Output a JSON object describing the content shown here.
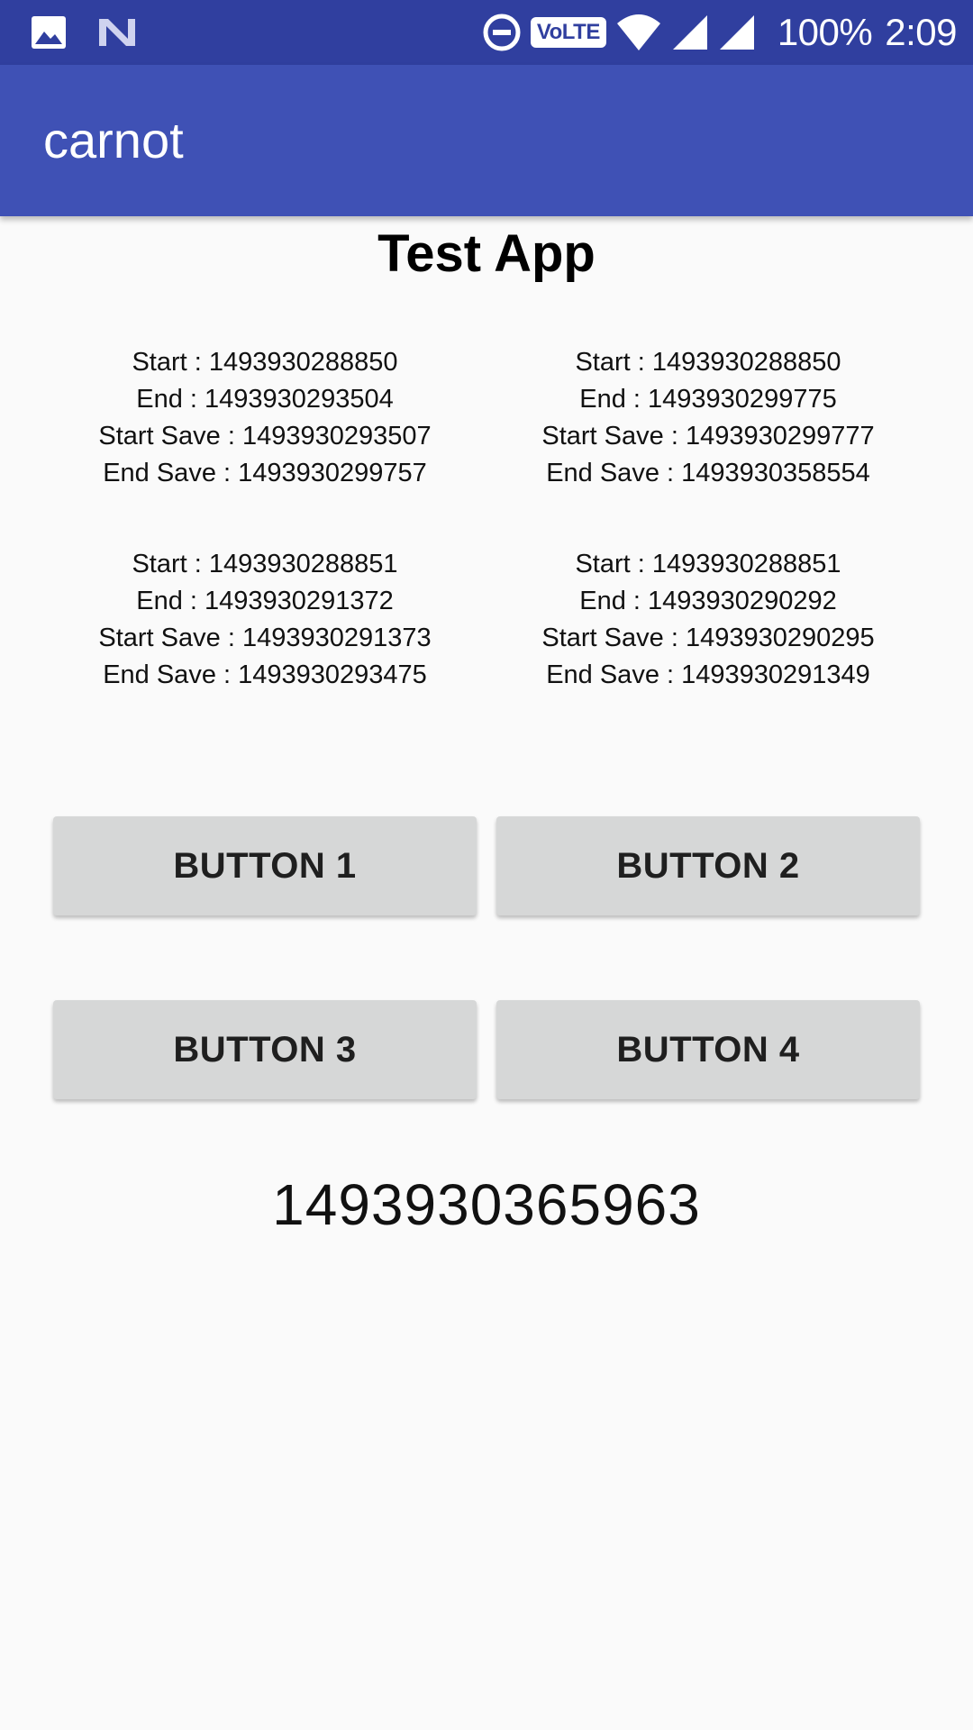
{
  "status_bar": {
    "left_icons": [
      "image-icon",
      "n-notification-icon"
    ],
    "right_icons": [
      "do-not-disturb-icon",
      "volte-badge",
      "wifi-icon",
      "signal-icon-1",
      "signal-icon-2"
    ],
    "volte_label": "VoLTE",
    "battery": "100%",
    "time": "2:09",
    "color": "#303f9f"
  },
  "app_bar": {
    "title": "carnot",
    "color": "#3f51b5"
  },
  "page": {
    "title": "Test App"
  },
  "stats": [
    {
      "start": "Start : 1493930288850",
      "end": "End : 1493930293504",
      "start_save": "Start Save : 1493930293507",
      "end_save": "End Save : 1493930299757"
    },
    {
      "start": "Start : 1493930288850",
      "end": "End : 1493930299775",
      "start_save": "Start Save : 1493930299777",
      "end_save": "End Save : 1493930358554"
    },
    {
      "start": "Start : 1493930288851",
      "end": "End : 1493930291372",
      "start_save": "Start Save : 1493930291373",
      "end_save": "End Save : 1493930293475"
    },
    {
      "start": "Start : 1493930288851",
      "end": "End : 1493930290292",
      "start_save": "Start Save : 1493930290295",
      "end_save": "End Save : 1493930291349"
    }
  ],
  "buttons": {
    "b1": "BUTTON 1",
    "b2": "BUTTON 2",
    "b3": "BUTTON 3",
    "b4": "BUTTON 4"
  },
  "timestamp": "1493930365963"
}
